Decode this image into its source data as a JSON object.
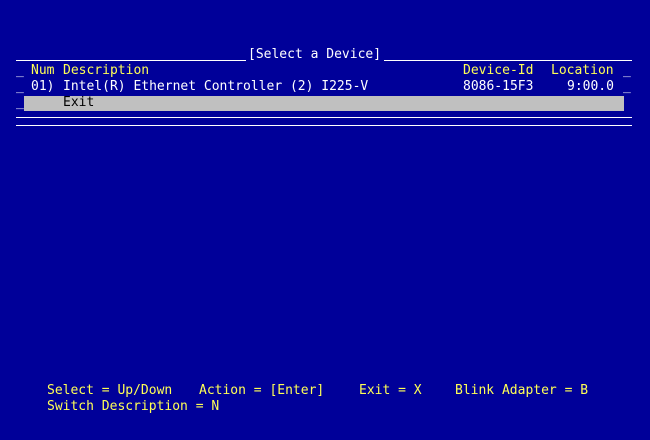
{
  "title": "[Select a Device]",
  "header": {
    "num": "Num",
    "description": "Description",
    "device_id": "Device-Id",
    "location": "Location"
  },
  "devices": [
    {
      "num": "01)",
      "description": "Intel(R) Ethernet Controller (2) I225-V",
      "device_id": "8086-15F3",
      "location": "9:00.0"
    }
  ],
  "exit_label": "Exit",
  "footer": {
    "select": "Select = Up/Down",
    "action": "Action = [Enter]",
    "exit": "Exit = X",
    "blink": "Blink Adapter = B",
    "switch": "Switch Description = N"
  },
  "colors": {
    "background": "#000099",
    "highlight": "#c0c0c0",
    "header_text": "#ffff55",
    "text": "#ffffff"
  }
}
